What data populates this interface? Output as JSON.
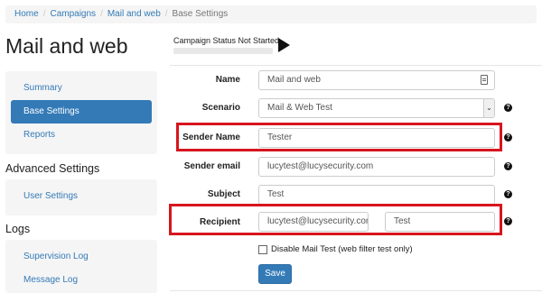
{
  "breadcrumb": [
    "Home",
    "Campaigns",
    "Mail and web",
    "Base Settings"
  ],
  "page_title": "Mail and web",
  "campaign_status": {
    "label": "Campaign Status Not Started",
    "progress": 0
  },
  "sidebar": {
    "main_items": [
      "Summary",
      "Base Settings",
      "Reports"
    ],
    "active_item": "Base Settings",
    "advanced_title": "Advanced Settings",
    "advanced_items": [
      "User Settings"
    ],
    "logs_title": "Logs",
    "logs_items": [
      "Supervision Log",
      "Message Log"
    ]
  },
  "form": {
    "name": {
      "label": "Name",
      "value": "Mail and web"
    },
    "scenario": {
      "label": "Scenario",
      "value": "Mail & Web Test"
    },
    "sender_name": {
      "label": "Sender Name",
      "value": "Tester"
    },
    "sender_email": {
      "label": "Sender email",
      "value": "lucytest@lucysecurity.com"
    },
    "subject": {
      "label": "Subject",
      "value": "Test"
    },
    "recipient": {
      "label": "Recipient",
      "email": "lucytest@lucysecurity.com",
      "name": "Test"
    },
    "disable_mail_test": {
      "label": "Disable Mail Test (web filter test only)",
      "checked": false
    },
    "save_label": "Save"
  },
  "help_glyph": "?",
  "colors": {
    "accent": "#337ab7",
    "highlight": "#d7151e"
  }
}
